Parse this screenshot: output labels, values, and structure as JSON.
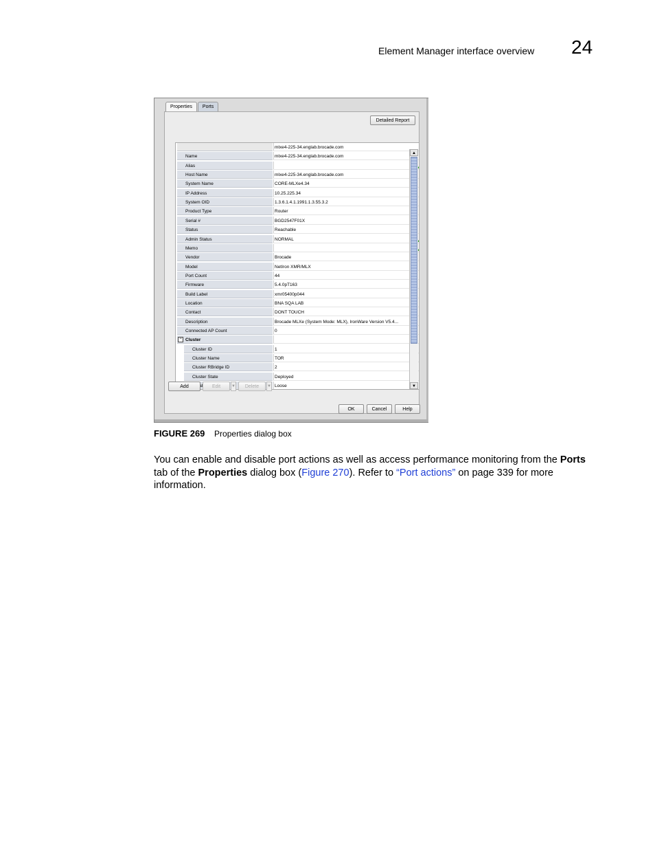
{
  "header": {
    "section_title": "Element Manager interface overview",
    "chapter_number": "24"
  },
  "dialog": {
    "tabs": [
      {
        "label": "Properties",
        "active": true
      },
      {
        "label": "Ports",
        "active": false
      }
    ],
    "detailed_report_label": "Detailed Report",
    "table_header_value": "mlxe4-225-34.englab.brocade.com",
    "rows": [
      {
        "name": "Name",
        "value": "mlxe4-225-34.englab.brocade.com"
      },
      {
        "name": "Alias",
        "value": "",
        "editable": true
      },
      {
        "name": "Host Name",
        "value": "mlxe4-225-34.englab.brocade.com"
      },
      {
        "name": "System Name",
        "value": "CORE-MLXe4.34"
      },
      {
        "name": "IP Address",
        "value": "10.25.225.34"
      },
      {
        "name": "System OID",
        "value": "1.3.6.1.4.1.1991.1.3.55.3.2"
      },
      {
        "name": "Product Type",
        "value": "Router"
      },
      {
        "name": "Serial #",
        "value": "BGD2547F01X"
      },
      {
        "name": "Status",
        "value": "Reachable"
      },
      {
        "name": "Admin Status",
        "value": " NORMAL",
        "editable": true
      },
      {
        "name": "Memo",
        "value": "",
        "editable": true
      },
      {
        "name": "Vendor",
        "value": "Brocade"
      },
      {
        "name": "Model",
        "value": "NetIron XMR/MLX"
      },
      {
        "name": "Port Count",
        "value": "44"
      },
      {
        "name": "Firmware",
        "value": "5.4.0pT163"
      },
      {
        "name": "Build Label",
        "value": "xmr05400p044"
      },
      {
        "name": "Location",
        "value": "BNA SQA LAB"
      },
      {
        "name": "Contact",
        "value": "DONT TOUCH"
      },
      {
        "name": "Description",
        "value": "Brocade MLXe (System Mode: MLX), IronWare Version V5.4..."
      },
      {
        "name": "Connected AP Count",
        "value": "0"
      }
    ],
    "cluster": {
      "label": "Cluster",
      "toggle": "−",
      "rows": [
        {
          "name": "Cluster ID",
          "value": "1"
        },
        {
          "name": "Cluster Name",
          "value": "TOR"
        },
        {
          "name": "Cluster RBridge ID",
          "value": "2"
        },
        {
          "name": "Cluster State",
          "value": "Deployed"
        },
        {
          "name": "Isolation Mode",
          "value": "Loose"
        }
      ]
    },
    "actions": {
      "add": "Add",
      "edit": "Edit",
      "delete": "Delete"
    },
    "footer_buttons": {
      "ok": "OK",
      "cancel": "Cancel",
      "help": "Help"
    }
  },
  "caption": {
    "label": "FIGURE 269",
    "text": "Properties dialog box"
  },
  "paragraph": {
    "t1": "You can enable and disable port actions as well as access performance monitoring from the ",
    "b1": "Ports",
    "t2": " tab of the ",
    "b2": "Properties",
    "t3": " dialog box (",
    "link1": "Figure 270",
    "t4": "). Refer to ",
    "link2": "“Port actions”",
    "t5": " on page 339 for more information."
  }
}
